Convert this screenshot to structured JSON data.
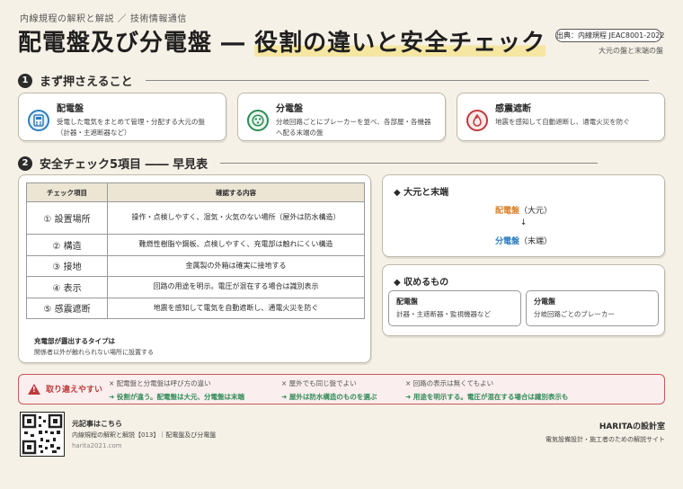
{
  "header": {
    "kicker": "内線規程の解釈と解説 ／ 技術情報通信",
    "title_a": "配電盤及び分電盤 ― ",
    "title_b": "役割の違いと安全チェック",
    "source": "出典：内線規程 JEAC8001-2022",
    "source_sub": "大元の盤と末端の盤"
  },
  "section1": {
    "number": "1",
    "title": "まず押さえること",
    "cards": [
      {
        "title": "配電盤",
        "desc": "受電した電気をまとめて管理・分配する大元の盤（計器・主遮断器など）",
        "icon": "calculator-icon",
        "color": "#2e7dbd"
      },
      {
        "title": "分電盤",
        "desc": "分岐回路ごとにブレーカーを並べ、各部屋・各機器へ配る末端の盤",
        "icon": "breaker-icon",
        "color": "#2e8b57"
      },
      {
        "title": "感震遮断",
        "desc": "地震を感知して自動遮断し、通電火災を防ぐ",
        "icon": "flame-icon",
        "color": "#c0393b"
      }
    ]
  },
  "section2": {
    "number": "2",
    "title": "安全チェック5項目 ―― 早見表",
    "headers": [
      "チェック項目",
      "確認する内容"
    ],
    "rows": [
      {
        "item": "① 設置場所",
        "content": "操作・点検しやすく、湿気・火気のない場所（屋外は防水構造）"
      },
      {
        "item": "② 構造",
        "content": "難燃性樹脂や鋼板、点検しやすく、充電部は触れにくい構造"
      },
      {
        "item": "③ 接地",
        "content": "金属製の外箱は確実に接地する"
      },
      {
        "item": "④ 表示",
        "content": "回路の用途を明示。電圧が混在する場合は識別表示"
      },
      {
        "item": "⑤ 感震遮断",
        "content": "地震を感知して電気を自動遮断し、通電火災を防ぐ"
      }
    ],
    "note_title": "充電部が露出するタイプは",
    "note_desc": "関係者以外が触れられない場所に設置する"
  },
  "hierarchy": {
    "title": "◆ 大元と末端",
    "top_name": "配電盤",
    "top_tag": "（大元）",
    "arrow": "↓",
    "bottom_name": "分電盤",
    "bottom_tag": "（末端）"
  },
  "contents": {
    "title": "◆ 収めるもの",
    "items": [
      {
        "title": "配電盤",
        "desc": "計器・主遮断器・監視機器など"
      },
      {
        "title": "分電盤",
        "desc": "分岐回路ごとのブレーカー"
      }
    ]
  },
  "warning": {
    "label": "取り違えやすい",
    "icon": "warning-icon",
    "items": [
      {
        "wrong": "× 配電盤と分電盤は呼び方の違い",
        "right": "➜ 役割が違う。配電盤は大元、分電盤は末端"
      },
      {
        "wrong": "× 屋外でも同じ盤でよい",
        "right": "➜ 屋外は防水構造のものを選ぶ"
      },
      {
        "wrong": "× 回路の表示は無くてもよい",
        "right": "➜ 用途を明示する。電圧が混在する場合は識別表示も"
      }
    ]
  },
  "footer": {
    "qr_label": "qr-code",
    "line1": "元記事はこちら",
    "line2": "内線規程の解釈と解説【013】｜配電盤及び分電盤",
    "line3": "harita2021.com",
    "brand": "HARITAの設計室",
    "brand_sub": "電気設備設計・施工者のための解説サイト"
  },
  "colors": {
    "accent_red": "#c0393b",
    "accent_blue": "#2e7dbd",
    "accent_orange": "#d9822b",
    "accent_green": "#2e8b57",
    "paper": "#f6f1e6"
  }
}
